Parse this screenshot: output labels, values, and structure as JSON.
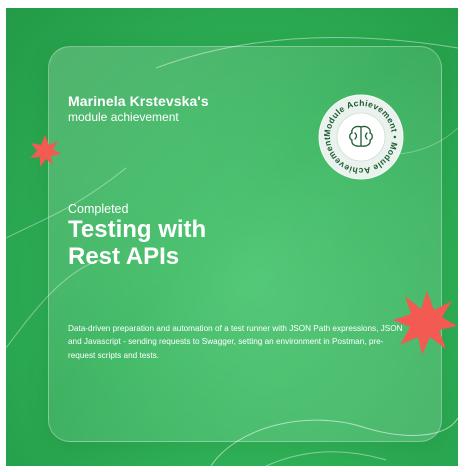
{
  "certificate": {
    "recipient": "Marinela Krstevska's",
    "subtitle": "module achievement",
    "status": "Completed",
    "course_title_line1": "Testing with",
    "course_title_line2": "Rest APIs",
    "description": "Data-driven preparation and automation of a test runner with JSON Path expressions, JSON and Javascript - sending requests to Swagger, setting an environment in Postman, pre-request scripts and tests."
  },
  "badge": {
    "ring_text": "Module Achievement • Module Achievement •",
    "icon": "brain-icon"
  },
  "colors": {
    "background": "#2fb257",
    "accent_star": "#f25a52",
    "text": "#ffffff"
  }
}
